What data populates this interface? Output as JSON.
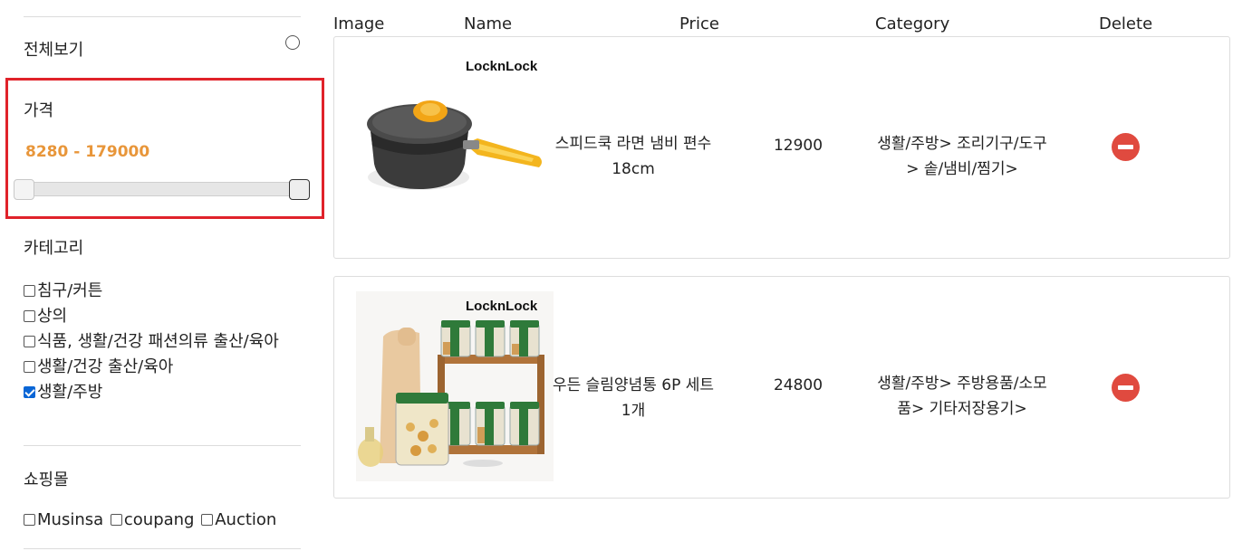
{
  "sidebar": {
    "view_all": "전체보기",
    "price": {
      "title": "가격",
      "range": "8280 - 179000",
      "min_value": 8280,
      "max_value": 179000
    },
    "category": {
      "title": "카테고리",
      "items": [
        {
          "label": "침구/커튼",
          "checked": false
        },
        {
          "label": "상의",
          "checked": false
        },
        {
          "label": "식품, 생활/건강 패션의류 출산/육아",
          "checked": false
        },
        {
          "label": "생활/건강 출산/육아",
          "checked": false
        },
        {
          "label": "생활/주방",
          "checked": true
        }
      ]
    },
    "mall": {
      "title": "쇼핑몰",
      "items": [
        {
          "label": "Musinsa",
          "checked": false
        },
        {
          "label": "coupang",
          "checked": false
        },
        {
          "label": "Auction",
          "checked": false
        }
      ]
    }
  },
  "table": {
    "headers": {
      "image": "Image",
      "name": "Name",
      "price": "Price",
      "category": "Category",
      "delete": "Delete"
    },
    "rows": [
      {
        "brand": "LocknLock",
        "name": "스피드쿡 라면 냄비 편수 18cm",
        "price": "12900",
        "category": "생활/주방> 조리기구/도구> 솥/냄비/찜기>",
        "image_icon": "saucepan-image"
      },
      {
        "brand": "LocknLock",
        "name": "우든 슬림양념통 6P 세트 1개",
        "price": "24800",
        "category": "생활/주방> 주방용품/소모품> 기타저장용기>",
        "image_icon": "spice-container-set-image"
      }
    ]
  },
  "colors": {
    "highlight_border": "#e0222a",
    "price_range_text": "#e8963a",
    "delete_button": "#e04a3f",
    "checkbox_checked": "#0a66d6"
  }
}
